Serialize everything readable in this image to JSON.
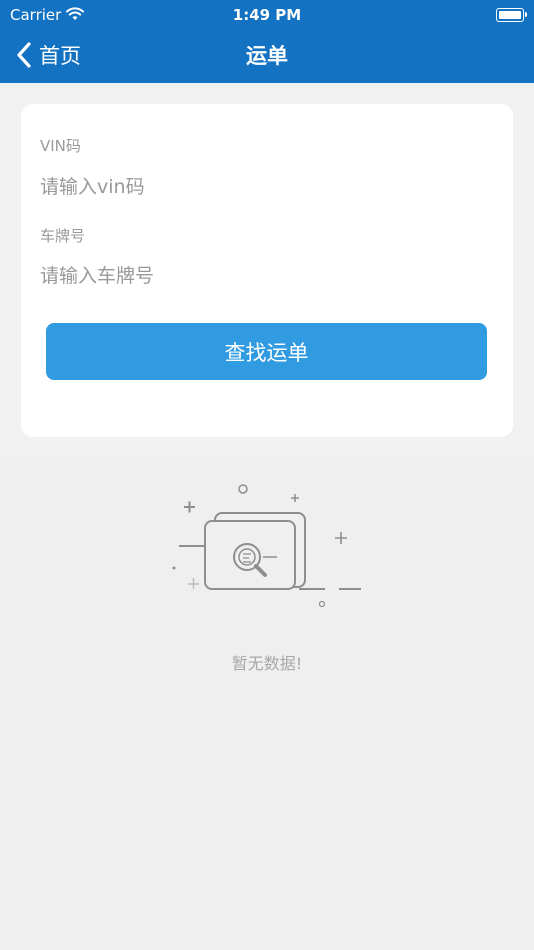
{
  "status_bar": {
    "carrier": "Carrier",
    "time": "1:49 PM"
  },
  "nav": {
    "back_label": "首页",
    "title": "运单"
  },
  "form": {
    "vin_label": "VIN码",
    "vin_placeholder": "请输入vin码",
    "plate_label": "车牌号",
    "plate_placeholder": "请输入车牌号",
    "search_button": "查找运单"
  },
  "empty_state": {
    "text": "暂无数据!"
  },
  "colors": {
    "header": "#1372c2",
    "button": "#309be0",
    "background": "#efefef"
  }
}
